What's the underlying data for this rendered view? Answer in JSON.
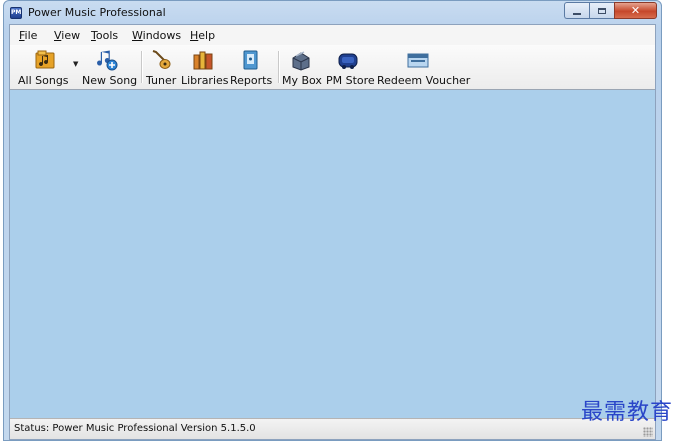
{
  "window": {
    "title": "Power Music Professional",
    "app_icon_text": "PM"
  },
  "menu": [
    {
      "label": "File",
      "accel": "F",
      "rest": "ile"
    },
    {
      "label": "View",
      "accel": "V",
      "rest": "iew"
    },
    {
      "label": "Tools",
      "accel": "T",
      "rest": "ools"
    },
    {
      "label": "Windows",
      "accel": "W",
      "rest": "indows"
    },
    {
      "label": "Help",
      "accel": "H",
      "rest": "elp"
    }
  ],
  "toolbar": {
    "all_songs": "All Songs",
    "new_song": "New Song",
    "tuner": "Tuner",
    "libraries": "Libraries",
    "reports": "Reports",
    "my_box": "My Box",
    "pm_store": "PM Store",
    "redeem_voucher": "Redeem Voucher"
  },
  "status": {
    "text": "Status:  Power Music Professional  Version 5.1.5.0"
  },
  "watermark": "最需教育",
  "colors": {
    "workspace": "#abcfeb",
    "close_button": "#c6472b"
  }
}
